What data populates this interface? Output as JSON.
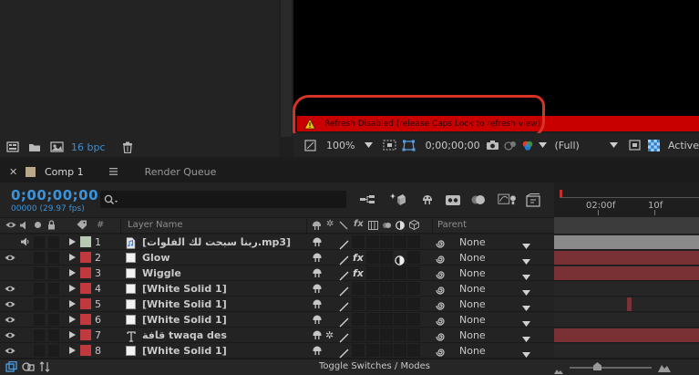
{
  "project_panel": {
    "bit_depth": "16 bpc"
  },
  "viewer": {
    "warning_text": "Refresh Disabled (release Caps Lock to refresh view)",
    "zoom": "100%",
    "timecode": "0;00;00;00",
    "resolution": "(Full)",
    "active_camera": "Active"
  },
  "tabs": {
    "comp_name": "Comp 1",
    "render_queue": "Render Queue"
  },
  "timeline": {
    "current_time": "0;00;00;00",
    "frame_info": "00000 (29.97 fps)",
    "search_placeholder": "",
    "ruler_ticks": [
      "02:00f",
      "10f"
    ],
    "columns": {
      "hash": "#",
      "layer_name": "Layer Name",
      "parent": "Parent"
    },
    "layers": [
      {
        "num": "1",
        "name": "[ربنا سبحت لك الفلوات.mp3]",
        "label_color": "#b7c9b2",
        "type": "audio",
        "parent": "None",
        "bar_color": "#8a8a8a",
        "fx": false
      },
      {
        "num": "2",
        "name": "Glow",
        "label_color": "#c0393f",
        "type": "solid",
        "parent": "None",
        "bar_color": "#7a3135",
        "fx": true
      },
      {
        "num": "3",
        "name": "Wiggle",
        "label_color": "#c0393f",
        "type": "solid",
        "parent": "None",
        "bar_color": "#7a3135",
        "fx": true
      },
      {
        "num": "4",
        "name": "[White Solid 1]",
        "label_color": "#c0393f",
        "type": "solid",
        "parent": "None",
        "bar_color": "",
        "fx": false
      },
      {
        "num": "5",
        "name": "[White Solid 1]",
        "label_color": "#c0393f",
        "type": "solid",
        "parent": "None",
        "bar_color": "",
        "fx": false
      },
      {
        "num": "6",
        "name": "[White Solid 1]",
        "label_color": "#c0393f",
        "type": "solid",
        "parent": "None",
        "bar_color": "",
        "fx": false
      },
      {
        "num": "7",
        "name": "قافة twaqa des",
        "label_color": "#c0393f",
        "type": "text",
        "parent": "None",
        "bar_color": "#7a3135",
        "fx": false
      },
      {
        "num": "8",
        "name": "[White Solid 1]",
        "label_color": "#c0393f",
        "type": "solid",
        "parent": "None",
        "bar_color": "",
        "fx": false
      }
    ],
    "toggle_label": "Toggle Switches / Modes"
  }
}
